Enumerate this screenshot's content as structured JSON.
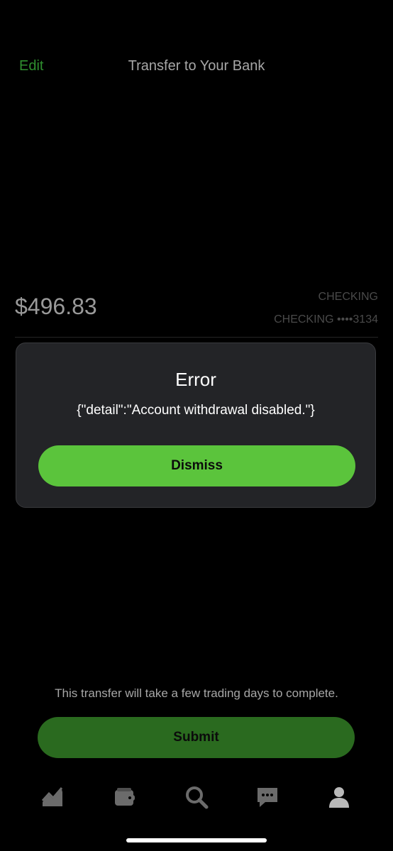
{
  "header": {
    "edit_label": "Edit",
    "title": "Transfer to Your Bank"
  },
  "transfer": {
    "amount": "$496.83",
    "account_type": "CHECKING",
    "account_label": "CHECKING ••••3134"
  },
  "error_modal": {
    "title": "Error",
    "message": "{\"detail\":\"Account withdrawal disabled.\"}",
    "dismiss_label": "Dismiss"
  },
  "footer": {
    "note": "This transfer will take a few trading days to complete.",
    "submit_label": "Submit"
  },
  "tabbar": {
    "items": [
      {
        "icon": "chart-icon"
      },
      {
        "icon": "wallet-icon"
      },
      {
        "icon": "search-icon"
      },
      {
        "icon": "messages-icon"
      },
      {
        "icon": "profile-icon"
      }
    ]
  },
  "colors": {
    "accent_green": "#5bc43c",
    "submit_green": "#2a6a1f",
    "edit_green": "#2f8f2f",
    "modal_bg": "#232427",
    "icon_gray": "#6b6b6b"
  }
}
